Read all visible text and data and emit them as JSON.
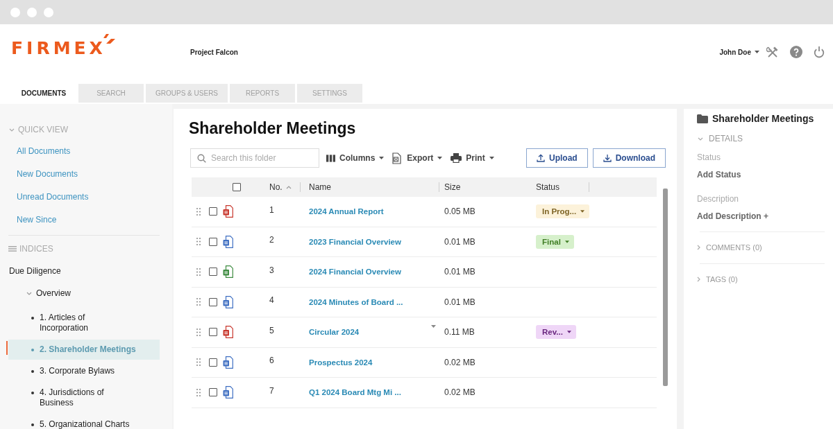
{
  "header": {
    "logo": "FIRMEX",
    "project": "Project Falcon",
    "user": "John Doe"
  },
  "tabs": [
    {
      "label": "DOCUMENTS",
      "selected": true
    },
    {
      "label": "SEARCH",
      "selected": false
    },
    {
      "label": "GROUPS & USERS",
      "selected": false
    },
    {
      "label": "REPORTS",
      "selected": false
    },
    {
      "label": "SETTINGS",
      "selected": false
    }
  ],
  "sidebar": {
    "quick_view": {
      "title": "QUICK VIEW",
      "expanded": true,
      "items": [
        {
          "label": "All Documents",
          "selected": false
        },
        {
          "label": "New Documents",
          "selected": false
        },
        {
          "label": "Unread Documents",
          "selected": false
        },
        {
          "label": "New Since",
          "selected": false
        }
      ]
    },
    "indices": {
      "title": "INDICES",
      "tree": [
        {
          "label": "Due Diligence",
          "selected": false,
          "children": [
            {
              "label": "Overview",
              "expanded": true,
              "selected": false,
              "children": [
                {
                  "label": "1. Articles of Incorporation",
                  "selected": false
                },
                {
                  "label": "2. Shareholder Meetings",
                  "selected": true
                },
                {
                  "label": "3. Corporate Bylaws",
                  "selected": false
                },
                {
                  "label": "4. Jurisdictions of Business",
                  "selected": false
                },
                {
                  "label": "5. Organizational Charts",
                  "selected": false
                }
              ]
            }
          ]
        }
      ]
    }
  },
  "folder": {
    "title": "Shareholder Meetings",
    "search": {
      "placeholder": "Search this folder"
    },
    "menus": [
      {
        "label": "Columns",
        "kind": "columns"
      },
      {
        "label": "Export",
        "kind": "export"
      },
      {
        "label": "Print",
        "kind": "print"
      }
    ],
    "buttons": [
      {
        "label": "Upload",
        "kind": "upload"
      },
      {
        "label": "Download",
        "kind": "download"
      }
    ]
  },
  "table": {
    "select_all": {
      "checked": false
    },
    "columns": [
      {
        "label": "No.",
        "sorted": true
      },
      {
        "label": "Name",
        "sorted": false
      },
      {
        "label": "Size",
        "sorted": false
      },
      {
        "label": "Status",
        "sorted": false
      }
    ],
    "rows": [
      {
        "kind": "pdf",
        "checked": false,
        "hovered": false,
        "no": "1",
        "name": "2024 Annual Report",
        "size": "0.05 MB",
        "status": {
          "label": "In Prog...",
          "color": "#fcf2da"
        }
      },
      {
        "kind": "word",
        "checked": false,
        "hovered": false,
        "no": "2",
        "name": "2023 Financial Overview",
        "size": "0.01 MB",
        "status": {
          "label": "Final",
          "color": "#d6f0cb"
        }
      },
      {
        "kind": "excel",
        "checked": false,
        "hovered": false,
        "no": "3",
        "name": "2024 Financial Overview",
        "size": "0.01 MB"
      },
      {
        "kind": "word",
        "checked": false,
        "hovered": false,
        "no": "4",
        "name": "2024 Minutes of Board ...",
        "size": "0.01 MB"
      },
      {
        "kind": "pdf",
        "checked": false,
        "hovered": true,
        "no": "5",
        "name": "Circular 2024",
        "size": "0.11 MB",
        "status": {
          "label": "Rev...",
          "color": "#efd6f7"
        }
      },
      {
        "kind": "word",
        "checked": false,
        "hovered": false,
        "no": "6",
        "name": "Prospectus 2024",
        "size": "0.02 MB"
      },
      {
        "kind": "word",
        "checked": false,
        "hovered": false,
        "no": "7",
        "name": "Q1 2024 Board Mtg Mi ...",
        "size": "0.02 MB"
      }
    ]
  },
  "details": {
    "title": "Shareholder Meetings",
    "sections": [
      {
        "title": "DETAILS",
        "expanded": true,
        "fields": [
          {
            "label": "Status",
            "value": "Add Status"
          },
          {
            "label": "Description",
            "value": "Add Description +"
          }
        ]
      },
      {
        "title": "COMMENTS (0)",
        "expanded": false
      },
      {
        "title": "TAGS (0)",
        "expanded": false
      }
    ]
  }
}
